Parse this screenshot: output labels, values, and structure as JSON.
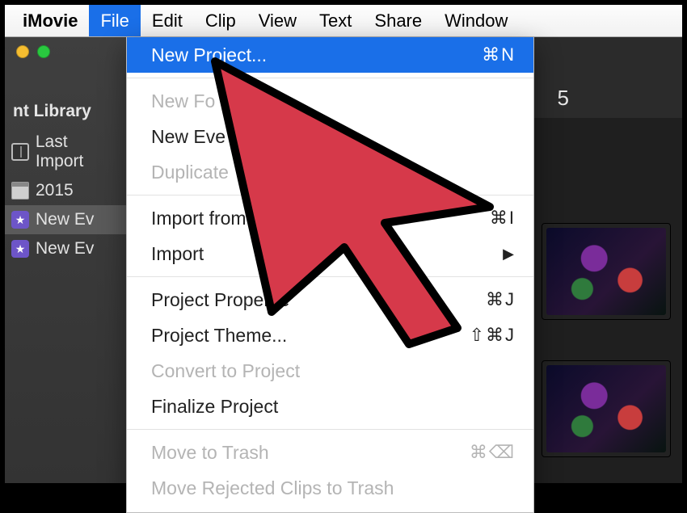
{
  "menubar": {
    "app": "iMovie",
    "items": [
      "File",
      "Edit",
      "Clip",
      "View",
      "Text",
      "Share",
      "Window"
    ],
    "active_index": 0
  },
  "sidebar": {
    "title": "nt Library",
    "rows": [
      {
        "icon": "clip",
        "label": "Last Import",
        "selected": false
      },
      {
        "icon": "cal",
        "label": "2015",
        "selected": false
      },
      {
        "icon": "star",
        "label": "New Ev",
        "selected": true
      },
      {
        "icon": "star",
        "label": "New Ev",
        "selected": false
      }
    ]
  },
  "content": {
    "date_label": "5"
  },
  "dropdown": {
    "rows": [
      {
        "type": "item",
        "label": "New Project...",
        "shortcut": "⌘N",
        "highlight": true,
        "disabled": false
      },
      {
        "type": "sep"
      },
      {
        "type": "item",
        "label": "New Fo",
        "shortcut": "",
        "highlight": false,
        "disabled": true
      },
      {
        "type": "item",
        "label": "New Eve",
        "shortcut": "",
        "highlight": false,
        "disabled": false
      },
      {
        "type": "item",
        "label": "Duplicate",
        "shortcut": "",
        "highlight": false,
        "disabled": true
      },
      {
        "type": "sep"
      },
      {
        "type": "item",
        "label": "Import from",
        "shortcut": "⌘I",
        "highlight": false,
        "disabled": false
      },
      {
        "type": "item",
        "label": "Import",
        "shortcut": "▶",
        "highlight": false,
        "disabled": false
      },
      {
        "type": "sep"
      },
      {
        "type": "item",
        "label": "Project Propertie",
        "shortcut": "⌘J",
        "highlight": false,
        "disabled": false
      },
      {
        "type": "item",
        "label": "Project Theme...",
        "shortcut": "⇧⌘J",
        "highlight": false,
        "disabled": false
      },
      {
        "type": "item",
        "label": "Convert to Project",
        "shortcut": "",
        "highlight": false,
        "disabled": true
      },
      {
        "type": "item",
        "label": "Finalize Project",
        "shortcut": "",
        "highlight": false,
        "disabled": false
      },
      {
        "type": "sep"
      },
      {
        "type": "item",
        "label": "Move to Trash",
        "shortcut": "⌘⌫",
        "highlight": false,
        "disabled": true
      },
      {
        "type": "item",
        "label": "Move Rejected Clips to Trash",
        "shortcut": "",
        "highlight": false,
        "disabled": true
      }
    ]
  },
  "cursor": {
    "color": "#d6394a",
    "stroke": "#000"
  }
}
